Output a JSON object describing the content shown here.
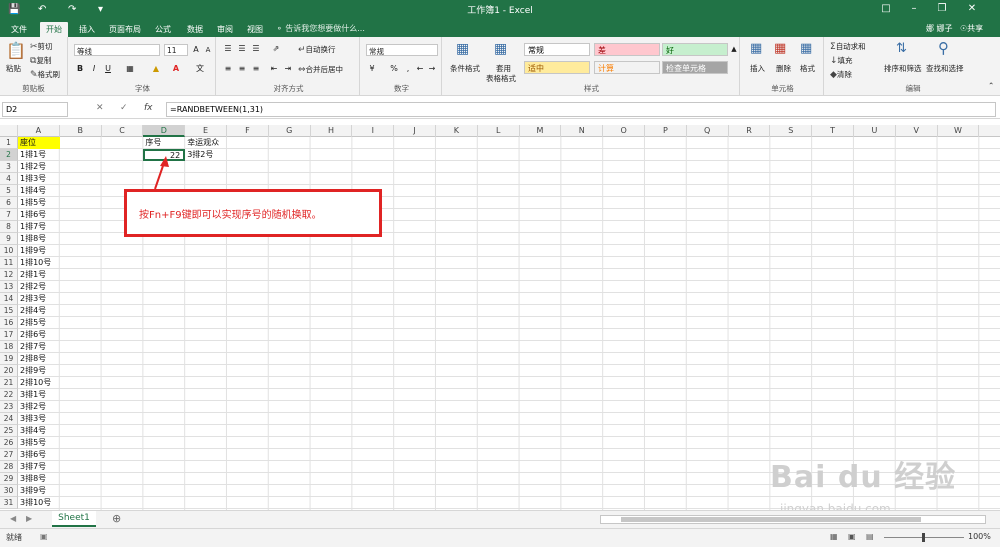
{
  "window": {
    "title": "工作簿1 - Excel"
  },
  "tabs": [
    "文件",
    "开始",
    "插入",
    "页面布局",
    "公式",
    "数据",
    "审阅",
    "视图"
  ],
  "active_tab": "开始",
  "tell_me": "告诉我您想要做什么...",
  "user": "娜 娜子",
  "share": "共享",
  "ribbon": {
    "clipboard": {
      "paste": "粘贴",
      "cut": "剪切",
      "copy": "复制",
      "format_painter": "格式刷",
      "label": "剪贴板"
    },
    "font": {
      "name": "等线",
      "size": "11",
      "label": "字体"
    },
    "alignment": {
      "wrap": "自动换行",
      "merge": "合并后居中",
      "label": "对齐方式"
    },
    "number": {
      "format": "常规",
      "label": "数字"
    },
    "styles": {
      "conditional": "条件格式",
      "table": "套用",
      "table2": "表格格式",
      "cells": [
        "常规",
        "差",
        "好",
        "适中",
        "计算",
        "检查单元格"
      ],
      "label": "样式"
    },
    "cells": {
      "insert": "插入",
      "delete": "删除",
      "format": "格式",
      "label": "单元格"
    },
    "editing": {
      "autosum": "自动求和",
      "fill": "填充",
      "clear": "清除",
      "sort": "排序和筛选",
      "find": "查找和选择",
      "label": "编辑"
    }
  },
  "formula_bar": {
    "name_box": "D2",
    "fx": "fx",
    "formula": "=RANDBETWEEN(1,31)"
  },
  "columns": [
    "A",
    "B",
    "C",
    "D",
    "E",
    "F",
    "G",
    "H",
    "I",
    "J",
    "K",
    "L",
    "M",
    "N",
    "O",
    "P",
    "Q",
    "R",
    "S",
    "T",
    "U",
    "V",
    "W"
  ],
  "rows": [
    "1",
    "2",
    "3",
    "4",
    "5",
    "6",
    "7",
    "8",
    "9",
    "10",
    "11",
    "12",
    "13",
    "14",
    "15",
    "16",
    "17",
    "18",
    "19",
    "20",
    "21",
    "22",
    "23",
    "24",
    "25",
    "26",
    "27",
    "28",
    "29",
    "30",
    "31"
  ],
  "column_a": [
    "座位",
    "1排1号",
    "1排2号",
    "1排3号",
    "1排4号",
    "1排5号",
    "1排6号",
    "1排7号",
    "1排8号",
    "1排9号",
    "1排10号",
    "2排1号",
    "2排2号",
    "2排3号",
    "2排4号",
    "2排5号",
    "2排6号",
    "2排7号",
    "2排8号",
    "2排9号",
    "2排10号",
    "3排1号",
    "3排2号",
    "3排3号",
    "3排4号",
    "3排5号",
    "3排6号",
    "3排7号",
    "3排8号",
    "3排9号",
    "3排10号"
  ],
  "d1": "序号",
  "e1": "幸运观众",
  "d2": "22",
  "e2": "3排2号",
  "callout": "按Fn+F9键即可以实现序号的随机换取。",
  "sheet_tab": "Sheet1",
  "status": {
    "ready": "就绪",
    "zoom": "100%"
  },
  "watermark": {
    "logo": "Bai du 经验",
    "url": "jingyan.baidu.com"
  },
  "colors": {
    "accent": "#217346",
    "callout": "#e02424",
    "highlight": "#ffff00"
  }
}
